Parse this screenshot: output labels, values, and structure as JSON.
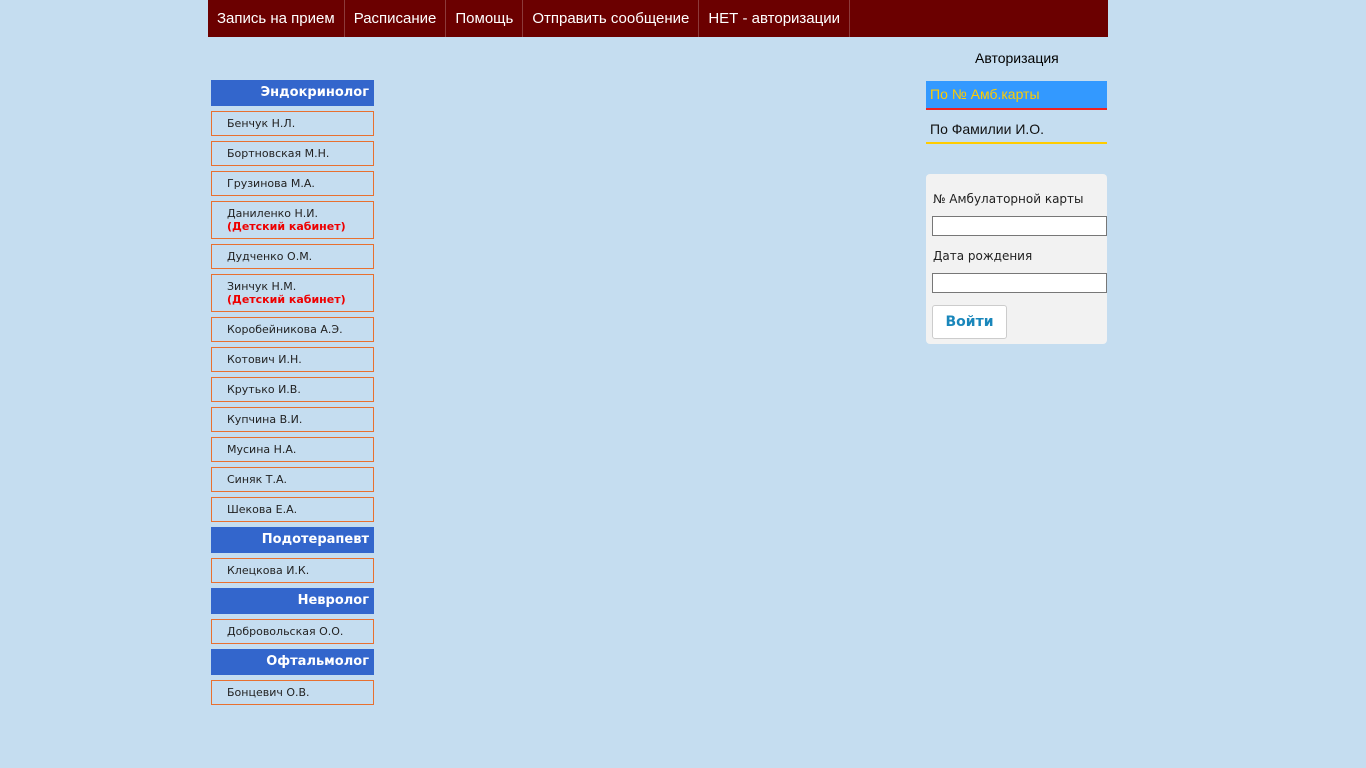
{
  "nav": {
    "items": [
      {
        "label": "Запись на прием"
      },
      {
        "label": "Расписание"
      },
      {
        "label": "Помощь"
      },
      {
        "label": "Отправить сообщение"
      },
      {
        "label": "НЕТ - авторизации"
      }
    ]
  },
  "sidebar": {
    "categories": [
      {
        "title": "Эндокринолог",
        "doctors": [
          {
            "name": "Бенчук Н.Л.",
            "note": ""
          },
          {
            "name": "Бортновская М.Н.",
            "note": ""
          },
          {
            "name": "Грузинова М.А.",
            "note": ""
          },
          {
            "name": "Даниленко Н.И.",
            "note": "(Детский кабинет)"
          },
          {
            "name": "Дудченко О.М.",
            "note": ""
          },
          {
            "name": "Зинчук Н.М.",
            "note": "(Детский кабинет)"
          },
          {
            "name": "Коробейникова А.Э.",
            "note": ""
          },
          {
            "name": "Котович И.Н.",
            "note": ""
          },
          {
            "name": "Крутько И.В.",
            "note": ""
          },
          {
            "name": "Купчина В.И.",
            "note": ""
          },
          {
            "name": "Мусина Н.А.",
            "note": ""
          },
          {
            "name": "Синяк Т.А.",
            "note": ""
          },
          {
            "name": "Шекова Е.А.",
            "note": ""
          }
        ]
      },
      {
        "title": "Подотерапевт",
        "doctors": [
          {
            "name": "Клецкова И.К.",
            "note": ""
          }
        ]
      },
      {
        "title": "Невролог",
        "doctors": [
          {
            "name": "Добровольская О.О.",
            "note": ""
          }
        ]
      },
      {
        "title": "Офтальмолог",
        "doctors": [
          {
            "name": "Бонцевич О.В.",
            "note": ""
          }
        ]
      }
    ]
  },
  "auth": {
    "title": "Авторизация",
    "tabs": [
      {
        "label": "По № Амб.карты"
      },
      {
        "label": "По Фамилии И.О."
      }
    ],
    "card_label": "№ Амбулаторной карты",
    "card_value": "",
    "dob_label": "Дата рождения",
    "dob_value": "",
    "login_label": "Войти"
  },
  "colors": {
    "background": "#c5ddf0",
    "nav_bg": "#6b0000",
    "category_bg": "#3366cc",
    "doctor_border": "#e87030",
    "note_text": "#ee0000",
    "active_tab_bg": "#3399ff",
    "active_tab_text": "#ffcc00",
    "login_text": "#1a87bb"
  }
}
